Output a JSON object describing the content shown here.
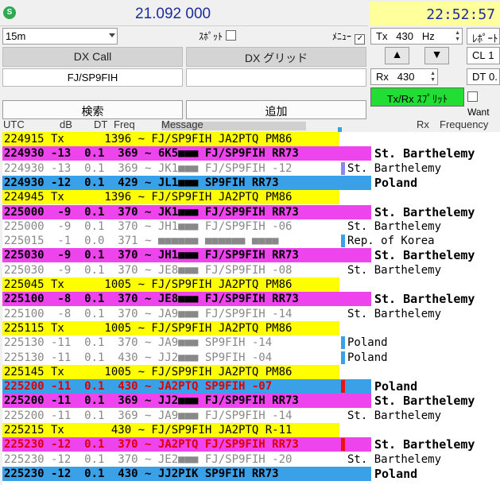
{
  "header": {
    "icon_letter": "S",
    "dial_frequency": "21.092 000",
    "clock": "22:52:57"
  },
  "controls": {
    "band": "15m",
    "spot_label": "ｽﾎﾟｯﾄ",
    "menu_label": "ﾒﾆｭｰ",
    "menu_check": "✓",
    "tx_label": "Tx",
    "tx_value": "430",
    "tx_unit": "Hz",
    "report_label": "ﾚﾎﾟｰﾄ",
    "up_glyph": "▲",
    "down_glyph": "▼",
    "cl_label": "CL",
    "cl_value": "1",
    "rx_label": "Rx",
    "rx_value": "430",
    "dt_label": "DT",
    "dt_value": "0.",
    "split_label": "Tx/Rx ｽﾌﾟﾘｯﾄ",
    "want_label": "Want",
    "colors": {
      "split_bg": "#22dd33",
      "clock_bg": "#ffff9c",
      "freq_text": "#1c2c9c"
    }
  },
  "dx": {
    "call_header": "DX Call",
    "grid_header": "DX グリッド",
    "call_value": "FJ/SP9FIH",
    "grid_value": "",
    "search_button": "検索",
    "add_button": "追加"
  },
  "table": {
    "columns": {
      "utc": "UTC",
      "db": "dB",
      "dt": "DT",
      "freq": "Freq",
      "message": "Message",
      "rx": "Rx",
      "frequency": "Frequency"
    },
    "rows": [
      {
        "text": "224915 Tx      1396 ~ FJ/SP9FIH JA2PTQ PM86",
        "country": "",
        "style": "tx"
      },
      {
        "text": "224930 -13  0.1  369 ~ 6K5■■■ FJ/SP9FIH RR73",
        "country": "St. Barthelemy",
        "style": "magenta"
      },
      {
        "text": "224930 -13  0.1  369 ~ JK1■■■ FJ/SP9FIH -12",
        "country": "St. Barthelemy",
        "style": "gray",
        "ind": "#8888ee"
      },
      {
        "text": "224930 -12  0.1  429 ~ JL1■■■ SP9FIH RR73",
        "country": "Poland",
        "style": "blue"
      },
      {
        "text": "224945 Tx      1396 ~ FJ/SP9FIH JA2PTQ PM86",
        "country": "",
        "style": "tx"
      },
      {
        "text": "225000  -9  0.1  370 ~ JK1■■■ FJ/SP9FIH RR73",
        "country": "St. Barthelemy",
        "style": "magenta"
      },
      {
        "text": "225000  -9  0.1  370 ~ JH1■■■ FJ/SP9FIH -06",
        "country": "St. Barthelemy",
        "style": "gray"
      },
      {
        "text": "225015  -1  0.0  371 ~ ■■■■■■ ■■■■■■ ■■■■",
        "country": "Rep. of Korea",
        "style": "plain",
        "ind": "#3aa0e8"
      },
      {
        "text": "225030  -9  0.1  370 ~ JH1■■■ FJ/SP9FIH RR73",
        "country": "St. Barthelemy",
        "style": "magenta"
      },
      {
        "text": "225030  -9  0.1  370 ~ JE8■■■ FJ/SP9FIH -08",
        "country": "St. Barthelemy",
        "style": "gray"
      },
      {
        "text": "225045 Tx      1005 ~ FJ/SP9FIH JA2PTQ PM86",
        "country": "",
        "style": "tx"
      },
      {
        "text": "225100  -8  0.1  370 ~ JE8■■■ FJ/SP9FIH RR73",
        "country": "St. Barthelemy",
        "style": "magenta"
      },
      {
        "text": "225100  -8  0.1  370 ~ JA9■■■ FJ/SP9FIH -14",
        "country": "St. Barthelemy",
        "style": "gray"
      },
      {
        "text": "225115 Tx      1005 ~ FJ/SP9FIH JA2PTQ PM86",
        "country": "",
        "style": "tx"
      },
      {
        "text": "225130 -11  0.1  370 ~ JA9■■■ SP9FIH -14",
        "country": "Poland",
        "style": "plain",
        "ind": "#3aa0e8"
      },
      {
        "text": "225130 -11  0.1  430 ~ JJ2■■■ SP9FIH -04",
        "country": "Poland",
        "style": "plain",
        "ind": "#3aa0e8"
      },
      {
        "text": "225145 Tx      1005 ~ FJ/SP9FIH JA2PTQ PM86",
        "country": "",
        "style": "tx"
      },
      {
        "text": "225200 -11  0.1  430 ~ JA2PTQ SP9FIH -07",
        "country": "Poland",
        "style": "blue-red",
        "ind": "#ee1111"
      },
      {
        "text": "225200 -11  0.1  369 ~ JJ2■■■ FJ/SP9FIH RR73",
        "country": "St. Barthelemy",
        "style": "magenta"
      },
      {
        "text": "225200 -11  0.1  369 ~ JA9■■■ FJ/SP9FIH -14",
        "country": "St. Barthelemy",
        "style": "gray"
      },
      {
        "text": "225215 Tx       430 ~ FJ/SP9FIH JA2PTQ R-11",
        "country": "",
        "style": "tx"
      },
      {
        "text": "225230 -12  0.1  370 ~ JA2PTQ FJ/SP9FIH RR73",
        "country": "St. Barthelemy",
        "style": "magenta-red",
        "ind": "#ee1111"
      },
      {
        "text": "225230 -12  0.1  370 ~ JE2■■■ FJ/SP9FIH -20",
        "country": "St. Barthelemy",
        "style": "gray"
      },
      {
        "text": "225230 -12  0.1  430 ~ JJ2PIK SP9FIH RR73",
        "country": "Poland",
        "style": "blue"
      }
    ]
  }
}
